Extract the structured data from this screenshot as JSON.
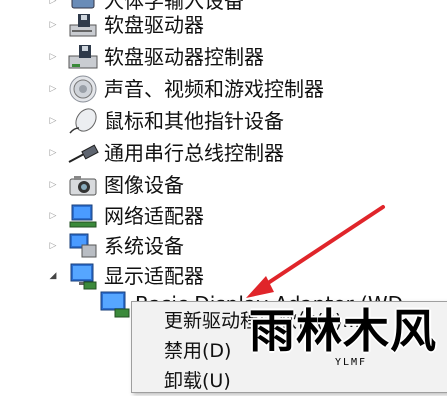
{
  "tree": {
    "items": [
      {
        "label": "人体学输入设备",
        "icon": "hid-icon",
        "expander": "▷"
      },
      {
        "label": "软盘驱动器",
        "icon": "floppy-drive-icon",
        "expander": "▷"
      },
      {
        "label": "软盘驱动器控制器",
        "icon": "floppy-controller-icon",
        "expander": "▷"
      },
      {
        "label": "声音、视频和游戏控制器",
        "icon": "speaker-icon",
        "expander": "▷"
      },
      {
        "label": "鼠标和其他指针设备",
        "icon": "mouse-icon",
        "expander": "▷"
      },
      {
        "label": "通用串行总线控制器",
        "icon": "usb-icon",
        "expander": "▷"
      },
      {
        "label": "图像设备",
        "icon": "camera-icon",
        "expander": "▷"
      },
      {
        "label": "网络适配器",
        "icon": "network-adapter-icon",
        "expander": "▷"
      },
      {
        "label": "系统设备",
        "icon": "system-devices-icon",
        "expander": "▷"
      },
      {
        "label": "显示适配器",
        "icon": "display-adapter-icon",
        "expander": "◢"
      }
    ],
    "child": {
      "label": "Basic Display Adapter (WD",
      "icon": "monitor-icon"
    }
  },
  "context_menu": {
    "items": [
      "更新驱动程序软件(P)...",
      "禁用(D)",
      "卸载(U)"
    ]
  },
  "watermark": {
    "glyphs": "雨林木风",
    "sub": "YLMF"
  },
  "colors": {
    "arrow": "#e0252a",
    "menu_bg": "#f2f2f2"
  }
}
